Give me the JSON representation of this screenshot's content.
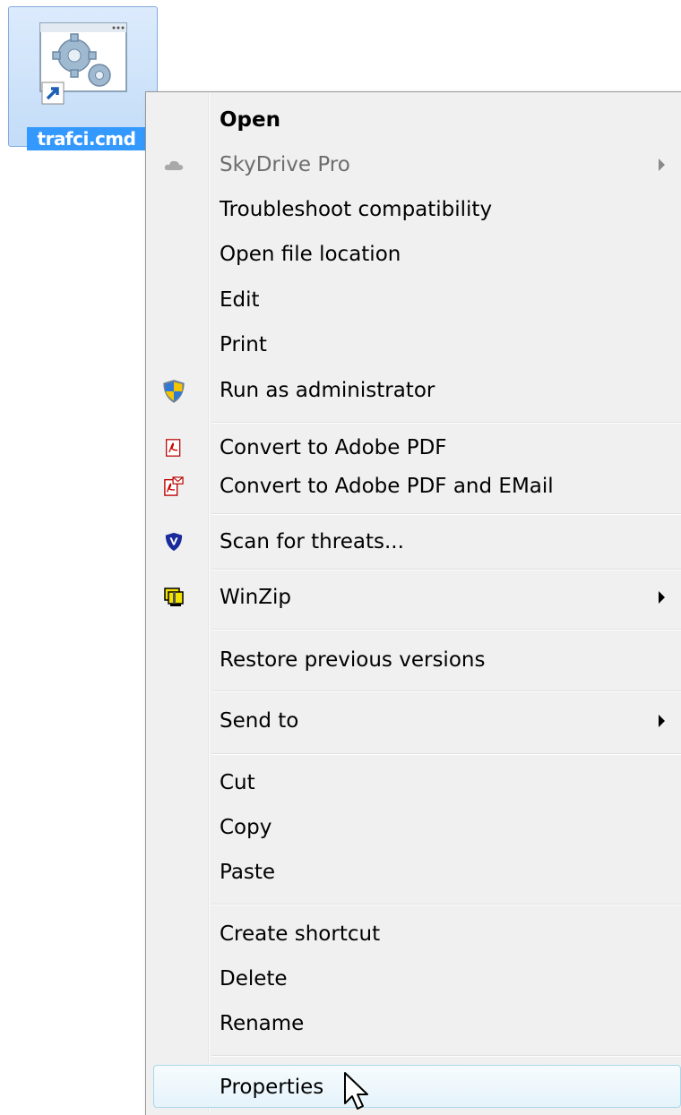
{
  "desktop": {
    "shortcut": {
      "label": "trafci.cmd",
      "icon": "gear-shortcut-icon"
    }
  },
  "context_menu": {
    "items": {
      "open": {
        "label": "Open"
      },
      "skydrive": {
        "label": "SkyDrive Pro",
        "icon": "cloud-icon"
      },
      "troubleshoot": {
        "label": "Troubleshoot compatibility"
      },
      "open_location": {
        "label": "Open file location"
      },
      "edit": {
        "label": "Edit"
      },
      "print": {
        "label": "Print"
      },
      "run_admin": {
        "label": "Run as administrator",
        "icon": "uac-shield-icon"
      },
      "convert_pdf": {
        "label": "Convert to Adobe PDF",
        "icon": "adobe-pdf-icon"
      },
      "convert_pdf_email": {
        "label": "Convert to Adobe PDF and EMail",
        "icon": "adobe-pdf-email-icon"
      },
      "scan": {
        "label": "Scan for threats...",
        "icon": "mcafee-shield-icon"
      },
      "winzip": {
        "label": "WinZip",
        "icon": "winzip-icon"
      },
      "restore": {
        "label": "Restore previous versions"
      },
      "send_to": {
        "label": "Send to"
      },
      "cut": {
        "label": "Cut"
      },
      "copy": {
        "label": "Copy"
      },
      "paste": {
        "label": "Paste"
      },
      "create_shortcut": {
        "label": "Create shortcut"
      },
      "delete": {
        "label": "Delete"
      },
      "rename": {
        "label": "Rename"
      },
      "properties": {
        "label": "Properties"
      }
    }
  },
  "colors": {
    "menu_background": "#f0f0f0",
    "selection": "#3399ff",
    "hover_border": "#a8d8eb",
    "disabled_text": "#6d6d6d"
  }
}
